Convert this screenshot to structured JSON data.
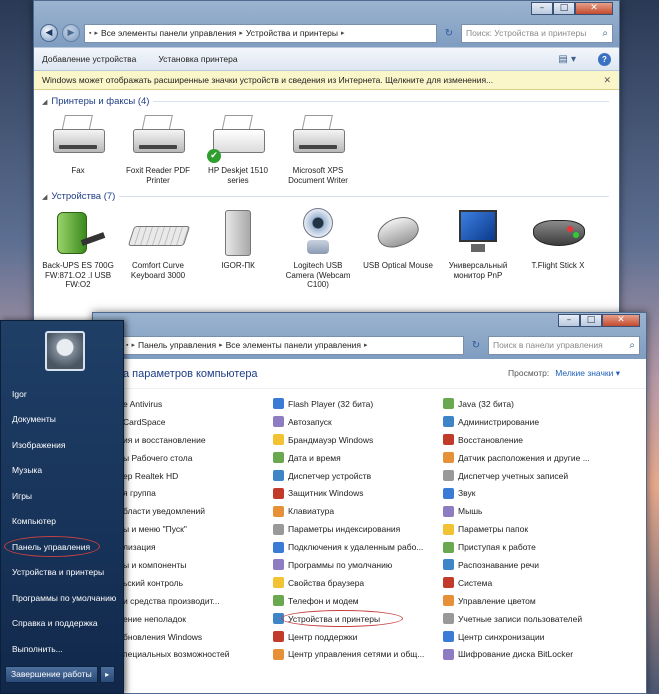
{
  "window1": {
    "controls": [
      "–",
      "□",
      "✕"
    ],
    "address": [
      "Все элементы панели управления",
      "Устройства и принтеры"
    ],
    "search_placeholder": "Поиск: Устройства и принтеры",
    "toolbar": {
      "add_device": "Добавление устройства",
      "add_printer": "Установка принтера"
    },
    "infobar": "Windows может отображать расширенные значки устройств и сведения из Интернета.  Щелкните для изменения...",
    "printers_group": "Принтеры и факсы (4)",
    "printers": [
      {
        "label": "Fax"
      },
      {
        "label": "Foxit Reader PDF\nPrinter"
      },
      {
        "label": "HP Deskjet 1510\nseries"
      },
      {
        "label": "Microsoft XPS\nDocument Writer"
      }
    ],
    "devices_group": "Устройства (7)",
    "devices": [
      {
        "label": "Back-UPS ES 700G\nFW:871.O2 .I USB\nFW:O2"
      },
      {
        "label": "Comfort Curve\nKeyboard 3000"
      },
      {
        "label": "IGOR-ПК"
      },
      {
        "label": "Logitech USB\nCamera (Webcam\nC100)"
      },
      {
        "label": "USB Optical Mouse"
      },
      {
        "label": "Универсальный\nмонитор PnP"
      },
      {
        "label": "T.Flight Stick X"
      }
    ]
  },
  "window2": {
    "controls": [
      "–",
      "□",
      "✕"
    ],
    "address": [
      "Панель управления",
      "Все элементы панели управления"
    ],
    "search_placeholder": "Поиск в панели управления",
    "title": "а параметров компьютера",
    "view_label": "Просмотр:",
    "view_value": "Мелкие значки ▾",
    "col1": [
      "e Antivirus",
      "CardSpace",
      "ия и восстановление",
      "ы Рабочего стола",
      "ер Realtek HD",
      "я группа",
      "бласти уведомлений",
      "ы и меню \"Пуск\"",
      "лизация",
      "ы и компоненты",
      "ьский контроль",
      "и средства производит...",
      "ение неполадок",
      "бновления Windows",
      "пециальных возможностей"
    ],
    "col2": [
      "Flash Player (32 бита)",
      "Автозапуск",
      "Брандмауэр Windows",
      "Дата и время",
      "Диспетчер устройств",
      "Защитник Windows",
      "Клавиатура",
      "Параметры индексирования",
      "Подключения к удаленным рабо...",
      "Программы по умолчанию",
      "Свойства браузера",
      "Телефон и модем",
      "Устройства и принтеры",
      "Центр поддержки",
      "Центр управления сетями и общ..."
    ],
    "col3": [
      "Java (32 бита)",
      "Администрирование",
      "Восстановление",
      "Датчик расположения и другие ...",
      "Диспетчер учетных записей",
      "Звук",
      "Мышь",
      "Параметры папок",
      "Приступая к работе",
      "Распознавание речи",
      "Система",
      "Управление цветом",
      "Учетные записи пользователей",
      "Центр синхронизации",
      "Шифрование диска BitLocker"
    ],
    "icon_colors": [
      "#c23b2a",
      "#3a7bd5",
      "#6aa84f",
      "#e69138",
      "#8e7cc3",
      "#3d85c6",
      "#999999",
      "#f1c232"
    ]
  },
  "startmenu": {
    "items": [
      "Igor",
      "Документы",
      "Изображения",
      "Музыка",
      "Игры",
      "Компьютер",
      "Панель управления",
      "Устройства и принтеры",
      "Программы по умолчанию",
      "Справка и поддержка",
      "Выполнить..."
    ],
    "shutdown": "Завершение работы",
    "shutdown_arrow": "▸"
  }
}
